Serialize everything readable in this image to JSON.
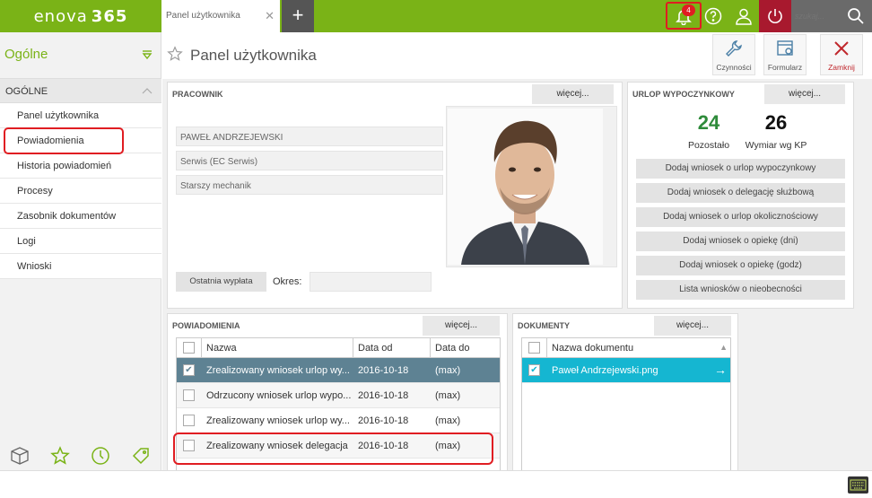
{
  "app": {
    "logo_text": "enova",
    "logo_num": "365"
  },
  "tabs": [
    {
      "label": "Panel użytkownika"
    }
  ],
  "topbar": {
    "notif_count": "4",
    "search_placeholder": "szukaj..."
  },
  "sidebar": {
    "title": "Ogólne",
    "group": "OGÓLNE",
    "items": [
      {
        "label": "Panel użytkownika"
      },
      {
        "label": "Powiadomienia"
      },
      {
        "label": "Historia powiadomień"
      },
      {
        "label": "Procesy"
      },
      {
        "label": "Zasobnik dokumentów"
      },
      {
        "label": "Logi"
      },
      {
        "label": "Wnioski"
      }
    ]
  },
  "header": {
    "title": "Panel użytkownika",
    "buttons": {
      "czynnosci": "Czynności",
      "formularz": "Formularz",
      "zamknij": "Zamknij"
    }
  },
  "employee": {
    "title": "PRACOWNIK",
    "more": "więcej...",
    "name": "PAWEŁ ANDRZEJEWSKI",
    "department": "Serwis (EC Serwis)",
    "position": "Starszy mechanik",
    "last_pay_button": "Ostatnia wypłata",
    "period_label": "Okres:",
    "period_value": ""
  },
  "leave": {
    "title": "URLOP WYPOCZYNKOWY",
    "more": "więcej...",
    "remaining_value": "24",
    "remaining_label": "Pozostało",
    "total_value": "26",
    "total_label": "Wymiar wg KP",
    "buttons": [
      "Dodaj wniosek o urlop wypoczynkowy",
      "Dodaj wniosek o delegację służbową",
      "Dodaj wniosek o urlop okolicznościowy",
      "Dodaj wniosek o opiekę (dni)",
      "Dodaj wniosek o opiekę (godz)",
      "Lista wniosków o nieobecności"
    ]
  },
  "notifications": {
    "title": "POWIADOMIENIA",
    "more": "więcej...",
    "columns": [
      "Nazwa",
      "Data od",
      "Data do"
    ],
    "rows": [
      {
        "name": "Zrealizowany wniosek urlop wy...",
        "from": "2016-10-18",
        "to": "(max)",
        "checked": true
      },
      {
        "name": "Odrzucony wniosek urlop wypo...",
        "from": "2016-10-18",
        "to": "(max)",
        "checked": false
      },
      {
        "name": "Zrealizowany wniosek urlop wy...",
        "from": "2016-10-18",
        "to": "(max)",
        "checked": false
      },
      {
        "name": "Zrealizowany wniosek delegacja",
        "from": "2016-10-18",
        "to": "(max)",
        "checked": false
      }
    ]
  },
  "documents": {
    "title": "DOKUMENTY",
    "more": "więcej...",
    "columns": [
      "Nazwa dokumentu"
    ],
    "rows": [
      {
        "name": "Paweł Andrzejewski.png",
        "checked": true
      }
    ]
  },
  "colors": {
    "brand_green": "#7ab317",
    "selected_row": "#5e8293",
    "doc_selected": "#15b6d1",
    "highlight_red": "#e01d22",
    "leave_green": "#2e8b3a"
  }
}
